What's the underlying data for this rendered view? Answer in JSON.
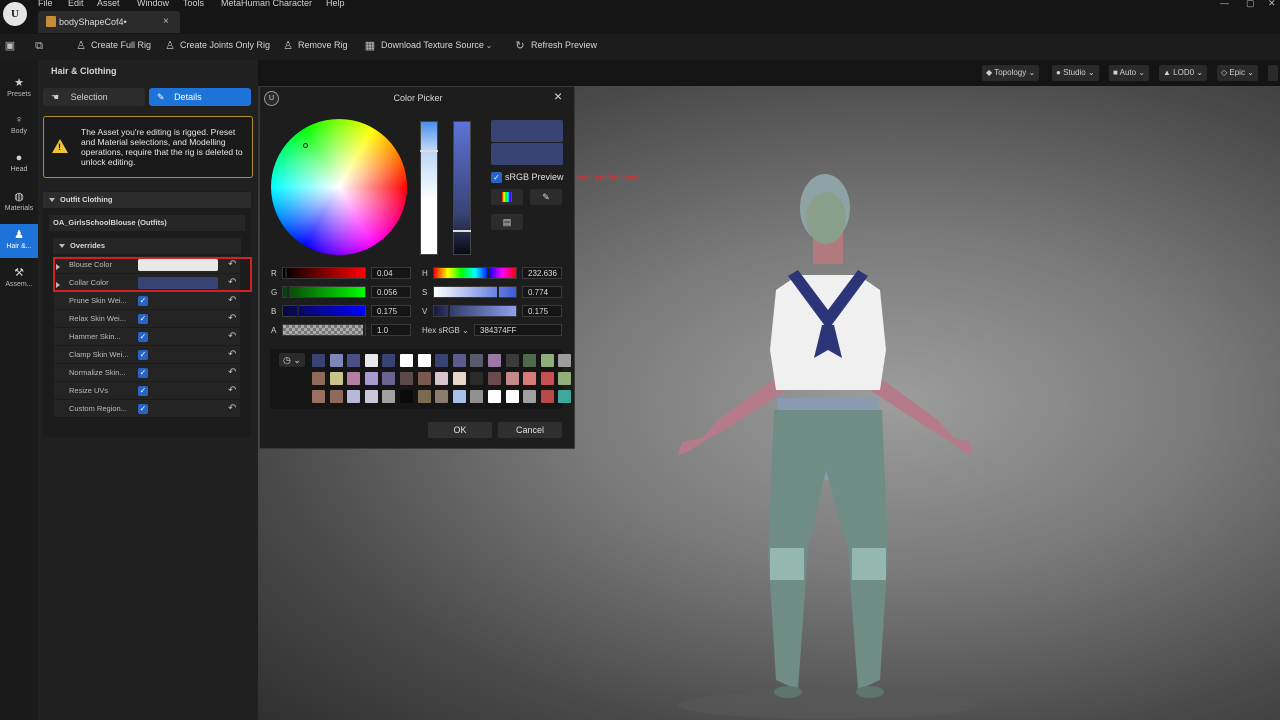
{
  "menubar": {
    "items": [
      "File",
      "Edit",
      "Asset",
      "Window",
      "Tools",
      "MetaHuman Character",
      "Help"
    ],
    "tab_title": "bodyShapeCof4•",
    "tab_close": "×",
    "window_controls": [
      "—",
      "▢",
      "✕"
    ]
  },
  "toolbar": {
    "create_full_rig": "Create Full Rig",
    "create_joints_only_rig": "Create Joints Only Rig",
    "remove_rig": "Remove Rig",
    "download_texture_source": "Download Texture Source",
    "refresh_preview": "Refresh Preview"
  },
  "left_nav": {
    "items": [
      {
        "label": "Presets",
        "icon": "star-icon"
      },
      {
        "label": "Body",
        "icon": "person-icon"
      },
      {
        "label": "Head",
        "icon": "head-icon"
      },
      {
        "label": "Materials",
        "icon": "sphere-icon"
      },
      {
        "label": "Hair &...",
        "icon": "hair-icon",
        "active": true
      },
      {
        "label": "Assem...",
        "icon": "hammer-icon"
      }
    ]
  },
  "panel": {
    "header": "Hair & Clothing",
    "tab_selection": "Selection",
    "tab_details": "Details",
    "warning": "The Asset you're editing is rigged. Preset and Material selections, and Modelling operations, require that the rig is deleted to unlock editing.",
    "section_outfit": "Outfit Clothing",
    "outfit_name": "OA_GirlsSchoolBlouse (Outfits)",
    "overrides": "Overrides",
    "rows": [
      {
        "label": "Blouse Color",
        "type": "color",
        "color": "#E8E8E8"
      },
      {
        "label": "Collar Color",
        "type": "color",
        "color": "#384374"
      },
      {
        "label": "Prune Skin Wei...",
        "type": "check",
        "checked": true
      },
      {
        "label": "Relax Skin Wei...",
        "type": "check",
        "checked": true
      },
      {
        "label": "Hammer Skin...",
        "type": "check",
        "checked": true
      },
      {
        "label": "Clamp Skin Wei...",
        "type": "check",
        "checked": true
      },
      {
        "label": "Normalize Skin...",
        "type": "check",
        "checked": true
      },
      {
        "label": "Resize UVs",
        "type": "check",
        "checked": true
      },
      {
        "label": "Custom Region...",
        "type": "check",
        "checked": true
      }
    ]
  },
  "viewport": {
    "buttons": [
      "Topology",
      "Studio",
      "Auto",
      "LOD0",
      "Epic"
    ],
    "perf_text": "poor performance"
  },
  "color_picker": {
    "title": "Color Picker",
    "srgb_preview": "sRGB Preview",
    "r_label": "R",
    "r_value": "0.04",
    "g_label": "G",
    "g_value": "0.056",
    "b_label": "B",
    "b_value": "0.175",
    "a_label": "A",
    "a_value": "1.0",
    "h_label": "H",
    "h_value": "232.636",
    "s_label": "S",
    "s_value": "0.774",
    "v_label": "V",
    "v_value": "0.175",
    "hex_label": "Hex sRGB",
    "hex_value": "384374FF",
    "ok": "OK",
    "cancel": "Cancel",
    "current_color": "#384374",
    "palette": [
      [
        "#384374",
        "#7f86b9",
        "#4a4f88",
        "#e8e8e8",
        "#384374",
        "#ffffff",
        "#ffffff",
        "#384374",
        "#5b5b8c",
        "#5a5a6a",
        "#9b78a8",
        "#3a3a3a",
        "#4e6a48",
        "#8fae7a",
        "#9c9c9c"
      ],
      [
        "#8f6a5a",
        "#c9c48a",
        "#b57da0",
        "#a69ad0",
        "#6c6490",
        "#5a4a48",
        "#7a5a50",
        "#d8c4d0",
        "#e6d8c8",
        "#2a2a2a",
        "#6a4a4a",
        "#c48a8a",
        "#d87a7a",
        "#c85050",
        "#8fae7a"
      ],
      [
        "#9a7060",
        "#8f6a5a",
        "#b8b8d8",
        "#c8c8d8",
        "#a0a0a0",
        "#0a0a0a",
        "#7a6a50",
        "#8a7a70",
        "#a6c0e8",
        "#909090",
        "#ffffff",
        "#ffffff",
        "#a0a0a0",
        "#b84a4a",
        "#3fa89a"
      ]
    ]
  }
}
